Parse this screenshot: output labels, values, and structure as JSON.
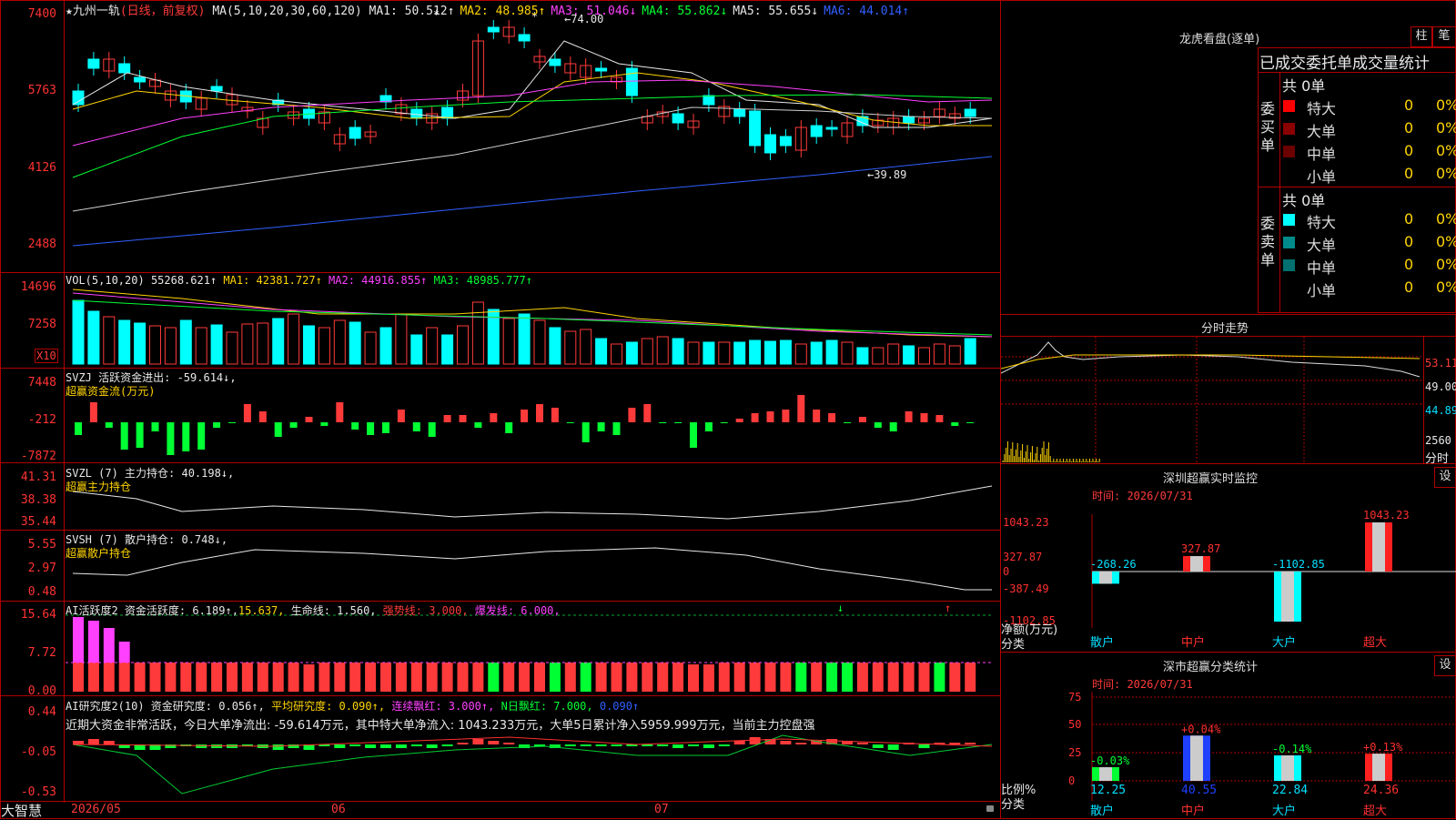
{
  "kline": {
    "title_star": "★",
    "stock_name": "九州一轨",
    "period_label": "(日线，前复权)",
    "ma_label": "MA(5,10,20,30,60,120)",
    "ma_values": [
      {
        "name": "MA1:",
        "value": "50.512↑",
        "color": "#e8e8e8"
      },
      {
        "name": "MA2:",
        "value": "48.985↑",
        "color": "#ffd400"
      },
      {
        "name": "MA3:",
        "value": "51.046↓",
        "color": "#ff40ff"
      },
      {
        "name": "MA4:",
        "value": "55.862↓",
        "color": "#00ff33"
      },
      {
        "name": "MA5:",
        "value": "55.655↓",
        "color": "#e8e8e8"
      },
      {
        "name": "MA6:",
        "value": "44.014↑",
        "color": "#3060ff"
      }
    ],
    "y_labels": [
      "7400",
      "5763",
      "4126",
      "2488"
    ],
    "high_note": "←74.00",
    "low_note": "←39.89"
  },
  "vol": {
    "label": "VOL(5,10,20)",
    "value": "55268.621↑",
    "ma1": "MA1: 42381.727↑",
    "ma2": "MA2: 44916.855↑",
    "ma3": "MA3: 48985.777↑",
    "y_labels": [
      "14696",
      "7258"
    ],
    "unit": "X10"
  },
  "svzj": {
    "label": "SVZJ  活跃资金进出: -59.614↓,",
    "sub": "超赢资金流(万元)",
    "y_labels": [
      "7448",
      "-212",
      "-7872"
    ]
  },
  "svzl": {
    "label": "SVZL (7) 主力持仓: 40.198↓,",
    "sub": "超赢主力持仓",
    "y_labels": [
      "41.31",
      "38.38",
      "35.44"
    ]
  },
  "svsh": {
    "label": "SVSH (7) 散户持仓: 0.748↓,",
    "sub": "超赢散户持仓",
    "y_labels": [
      "5.55",
      "2.97",
      "0.48"
    ]
  },
  "ai1": {
    "label": "AI活跃度2 资金活跃度: 6.189↑,",
    "v2": "15.637,",
    "life": "生命线: 1.560,",
    "strong": "强势线: 3.000,",
    "burst": "爆发线: 6.000,",
    "y_labels": [
      "15.64",
      "7.72",
      "0.00"
    ]
  },
  "ai2": {
    "label": "AI研究度2(10) 资金研究度: 0.056↑,",
    "avg": "平均研究度: 0.090↑,",
    "consec": "连续飘红: 3.000↑,",
    "nday": "N日飘红: 7.000,",
    "nday_v": "0.090↑",
    "comment": "近期大资金非常活跃，今日大单净流出: -59.614万元，其中特大单净流入: 1043.233万元，大单5日累计净入5959.999万元，当前主力控盘强",
    "y_labels": [
      "0.44",
      "-0.05",
      "-0.53"
    ]
  },
  "bottom": {
    "brand": "大智慧",
    "dates": [
      "2026/05",
      "06",
      "07"
    ]
  },
  "right": {
    "lhb_title": "龙虎看盘(逐单)",
    "btn_bar": "柱",
    "btn_pen": "笔",
    "stat_title": "已成交委托单成交量统计",
    "buy_side": "委买单",
    "sell_side": "委卖单",
    "total_buy": "共 0单",
    "total_sell": "共 0单",
    "buy_rows": [
      {
        "name": "特大",
        "count": "0",
        "pct": "0%",
        "color": "#ff0000"
      },
      {
        "name": "大单",
        "count": "0",
        "pct": "0%",
        "color": "#8b0000"
      },
      {
        "name": "中单",
        "count": "0",
        "pct": "0%",
        "color": "#6b0000"
      },
      {
        "name": "小单",
        "count": "0",
        "pct": "0%",
        "color": "#000000"
      }
    ],
    "sell_rows": [
      {
        "name": "特大",
        "count": "0",
        "pct": "0%",
        "color": "#00ffff"
      },
      {
        "name": "大单",
        "count": "0",
        "pct": "0%",
        "color": "#008b8b"
      },
      {
        "name": "中单",
        "count": "0",
        "pct": "0%",
        "color": "#007070"
      },
      {
        "name": "小单",
        "count": "0",
        "pct": "0%",
        "color": "#000000"
      }
    ],
    "intraday_title": "分时走势",
    "intraday_y": [
      "53.11",
      "49.00",
      "44.89"
    ],
    "intraday_vol": "2560",
    "intraday_unit": "分时",
    "monitor_title": "深圳超赢实时监控",
    "monitor_btn": "设",
    "monitor_time": "时间: 2026/07/31",
    "monitor_y": [
      "1043.23",
      "327.87",
      "0",
      "-387.49",
      "-1102.85"
    ],
    "monitor_axis_label": "净额(万元)",
    "monitor_axis_label2": "分类",
    "monitor_bars": [
      {
        "cat": "散户",
        "value": "-268.26"
      },
      {
        "cat": "中户",
        "value": "327.87"
      },
      {
        "cat": "大户",
        "value": "-1102.85"
      },
      {
        "cat": "超大",
        "value": "1043.23"
      }
    ],
    "class_title": "深市超赢分类统计",
    "class_btn": "设",
    "class_time": "时间: 2026/07/31",
    "class_y": [
      "75",
      "50",
      "25",
      "0"
    ],
    "class_axis_label": "比例%",
    "class_axis_label2": "分类",
    "class_bars": [
      {
        "cat": "散户",
        "value": "12.25",
        "chg": "-0.03%"
      },
      {
        "cat": "中户",
        "value": "40.55",
        "chg": "+0.04%"
      },
      {
        "cat": "大户",
        "value": "22.84",
        "chg": "-0.14%"
      },
      {
        "cat": "超大",
        "value": "24.36",
        "chg": "+0.13%"
      }
    ]
  },
  "colors": {
    "up": "#ff3a3a",
    "down": "#00ffff",
    "grid": "#b00000",
    "ma1": "#e8e8e8",
    "ma2": "#ffd400",
    "ma3": "#ff40ff",
    "ma4": "#00ff33",
    "ma5": "#d0d0d0",
    "ma6": "#3060ff"
  }
}
